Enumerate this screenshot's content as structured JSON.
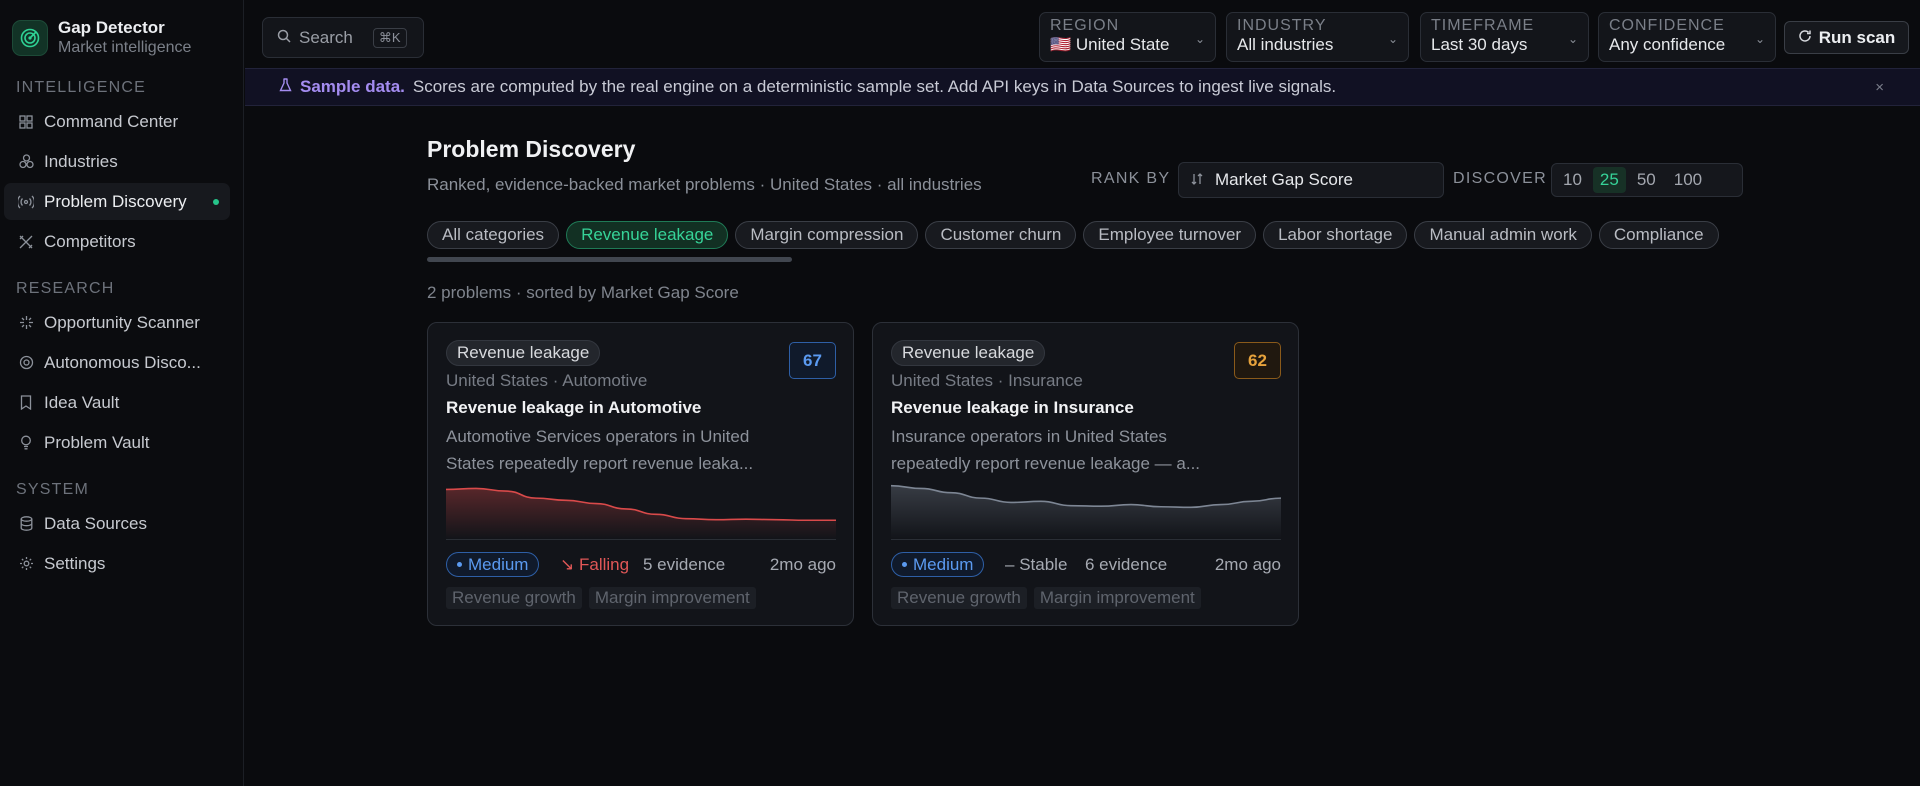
{
  "app": {
    "name": "Gap Detector",
    "subtitle": "Market intelligence"
  },
  "sidebar": {
    "sections": [
      {
        "title": "INTELLIGENCE",
        "items": [
          {
            "label": "Command Center",
            "icon": "grid-icon"
          },
          {
            "label": "Industries",
            "icon": "cubes-icon"
          },
          {
            "label": "Problem Discovery",
            "icon": "radar-icon",
            "active": true
          },
          {
            "label": "Competitors",
            "icon": "swords-icon"
          }
        ]
      },
      {
        "title": "RESEARCH",
        "items": [
          {
            "label": "Opportunity Scanner",
            "icon": "sparkle-icon"
          },
          {
            "label": "Autonomous Disco...",
            "icon": "orbit-icon"
          },
          {
            "label": "Idea Vault",
            "icon": "bookmark-icon"
          },
          {
            "label": "Problem Vault",
            "icon": "lightbulb-icon"
          }
        ]
      },
      {
        "title": "SYSTEM",
        "items": [
          {
            "label": "Data Sources",
            "icon": "database-icon"
          },
          {
            "label": "Settings",
            "icon": "gear-icon"
          }
        ]
      }
    ]
  },
  "topbar": {
    "search_label": "Search",
    "search_shortcut": "⌘K",
    "filters": {
      "region": {
        "label": "REGION",
        "value": "United State",
        "flag": "🇺🇸"
      },
      "industry": {
        "label": "INDUSTRY",
        "value": "All industries"
      },
      "timeframe": {
        "label": "TIMEFRAME",
        "value": "Last 30 days"
      },
      "confidence": {
        "label": "CONFIDENCE",
        "value": "Any confidence"
      }
    },
    "run_scan_label": "Run scan"
  },
  "banner": {
    "bold": "Sample data.",
    "text": "Scores are computed by the real engine on a deterministic sample set. Add API keys in Data Sources to ingest live signals.",
    "close": "×"
  },
  "main": {
    "title": "Problem Discovery",
    "subtitle": "Ranked, evidence-backed market problems · United States · all industries",
    "rank_by_label": "RANK BY",
    "rank_by_value": "Market Gap Score",
    "discover_label": "DISCOVER",
    "discover_options": [
      "10",
      "25",
      "50",
      "100"
    ],
    "discover_selected": "25",
    "categories": [
      "All categories",
      "Revenue leakage",
      "Margin compression",
      "Customer churn",
      "Employee turnover",
      "Labor shortage",
      "Manual admin work",
      "Compliance"
    ],
    "selected_category": "Revenue leakage",
    "count_text": "2 problems · sorted by Market Gap Score"
  },
  "cards": [
    {
      "category": "Revenue leakage",
      "score": "67",
      "location": "United States · Automotive",
      "title": "Revenue leakage in Automotive",
      "description": "Automotive Services operators in United States repeatedly report revenue leaka...",
      "severity": "Medium",
      "trend": "Falling",
      "trend_icon": "↘",
      "evidence": "5 evidence",
      "age": "2mo ago",
      "tags": [
        "Revenue growth",
        "Margin improvement"
      ],
      "spark_color": "#d94a4a",
      "spark": [
        0.88,
        0.9,
        0.85,
        0.72,
        0.68,
        0.62,
        0.52,
        0.42,
        0.34,
        0.32,
        0.33,
        0.32,
        0.31,
        0.31
      ]
    },
    {
      "category": "Revenue leakage",
      "score": "62",
      "location": "United States · Insurance",
      "title": "Revenue leakage in Insurance",
      "description": "Insurance operators in United States repeatedly report revenue leakage — a...",
      "severity": "Medium",
      "trend": "Stable",
      "trend_icon": "–",
      "evidence": "6 evidence",
      "age": "2mo ago",
      "tags": [
        "Revenue growth",
        "Margin improvement"
      ],
      "spark_color": "#7d8694",
      "spark": [
        0.95,
        0.9,
        0.82,
        0.72,
        0.64,
        0.66,
        0.58,
        0.57,
        0.6,
        0.56,
        0.55,
        0.6,
        0.66,
        0.72
      ]
    }
  ]
}
